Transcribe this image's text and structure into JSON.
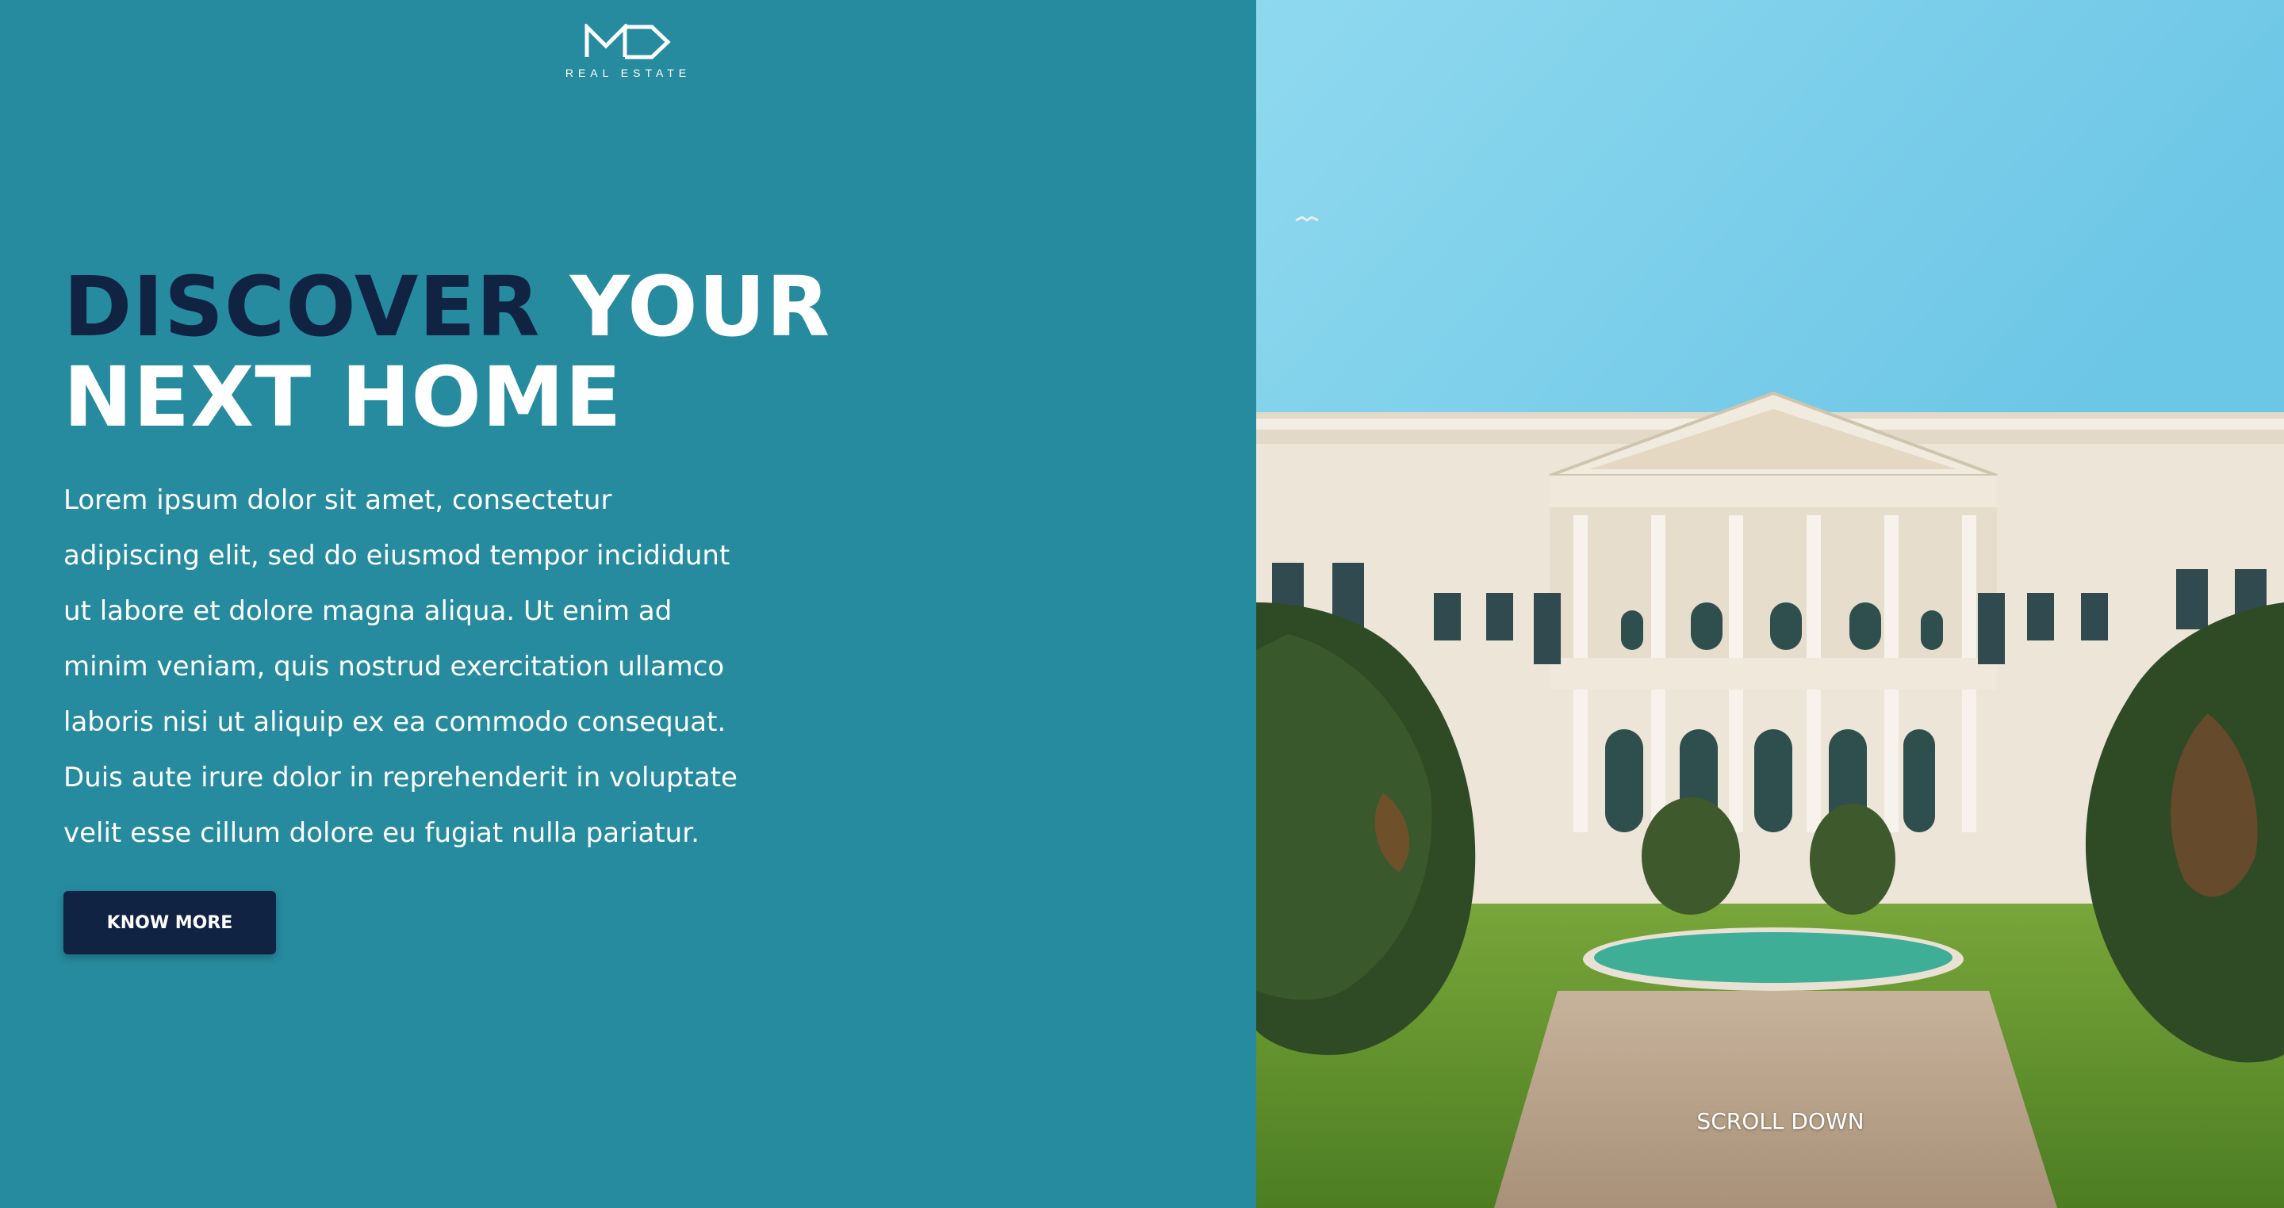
{
  "brand": {
    "logo_mark": "MD",
    "logo_sub": "REAL ESTATE"
  },
  "hero": {
    "headline_accent": "DISCOVER",
    "headline_rest_1": "YOUR",
    "headline_line_2": "NEXT HOME",
    "body_lines": [
      "Lorem ipsum dolor sit amet, consectetur",
      "adipiscing elit, sed do eiusmod tempor incididunt",
      "ut labore et dolore magna aliqua. Ut enim ad",
      "minim veniam, quis nostrud exercitation ullamco",
      "laboris nisi ut aliquip ex ea commodo consequat.",
      "Duis aute irure dolor in reprehenderit in voluptate",
      "velit esse cillum dolore eu fugiat nulla pariatur."
    ],
    "cta_label": "KNOW MORE"
  },
  "image": {
    "scroll_label": "SCROLL DOWN"
  },
  "colors": {
    "background": "#268b9e",
    "navy": "#102342",
    "white": "#ffffff"
  },
  "icons": {
    "logo": "md-logo-icon"
  }
}
